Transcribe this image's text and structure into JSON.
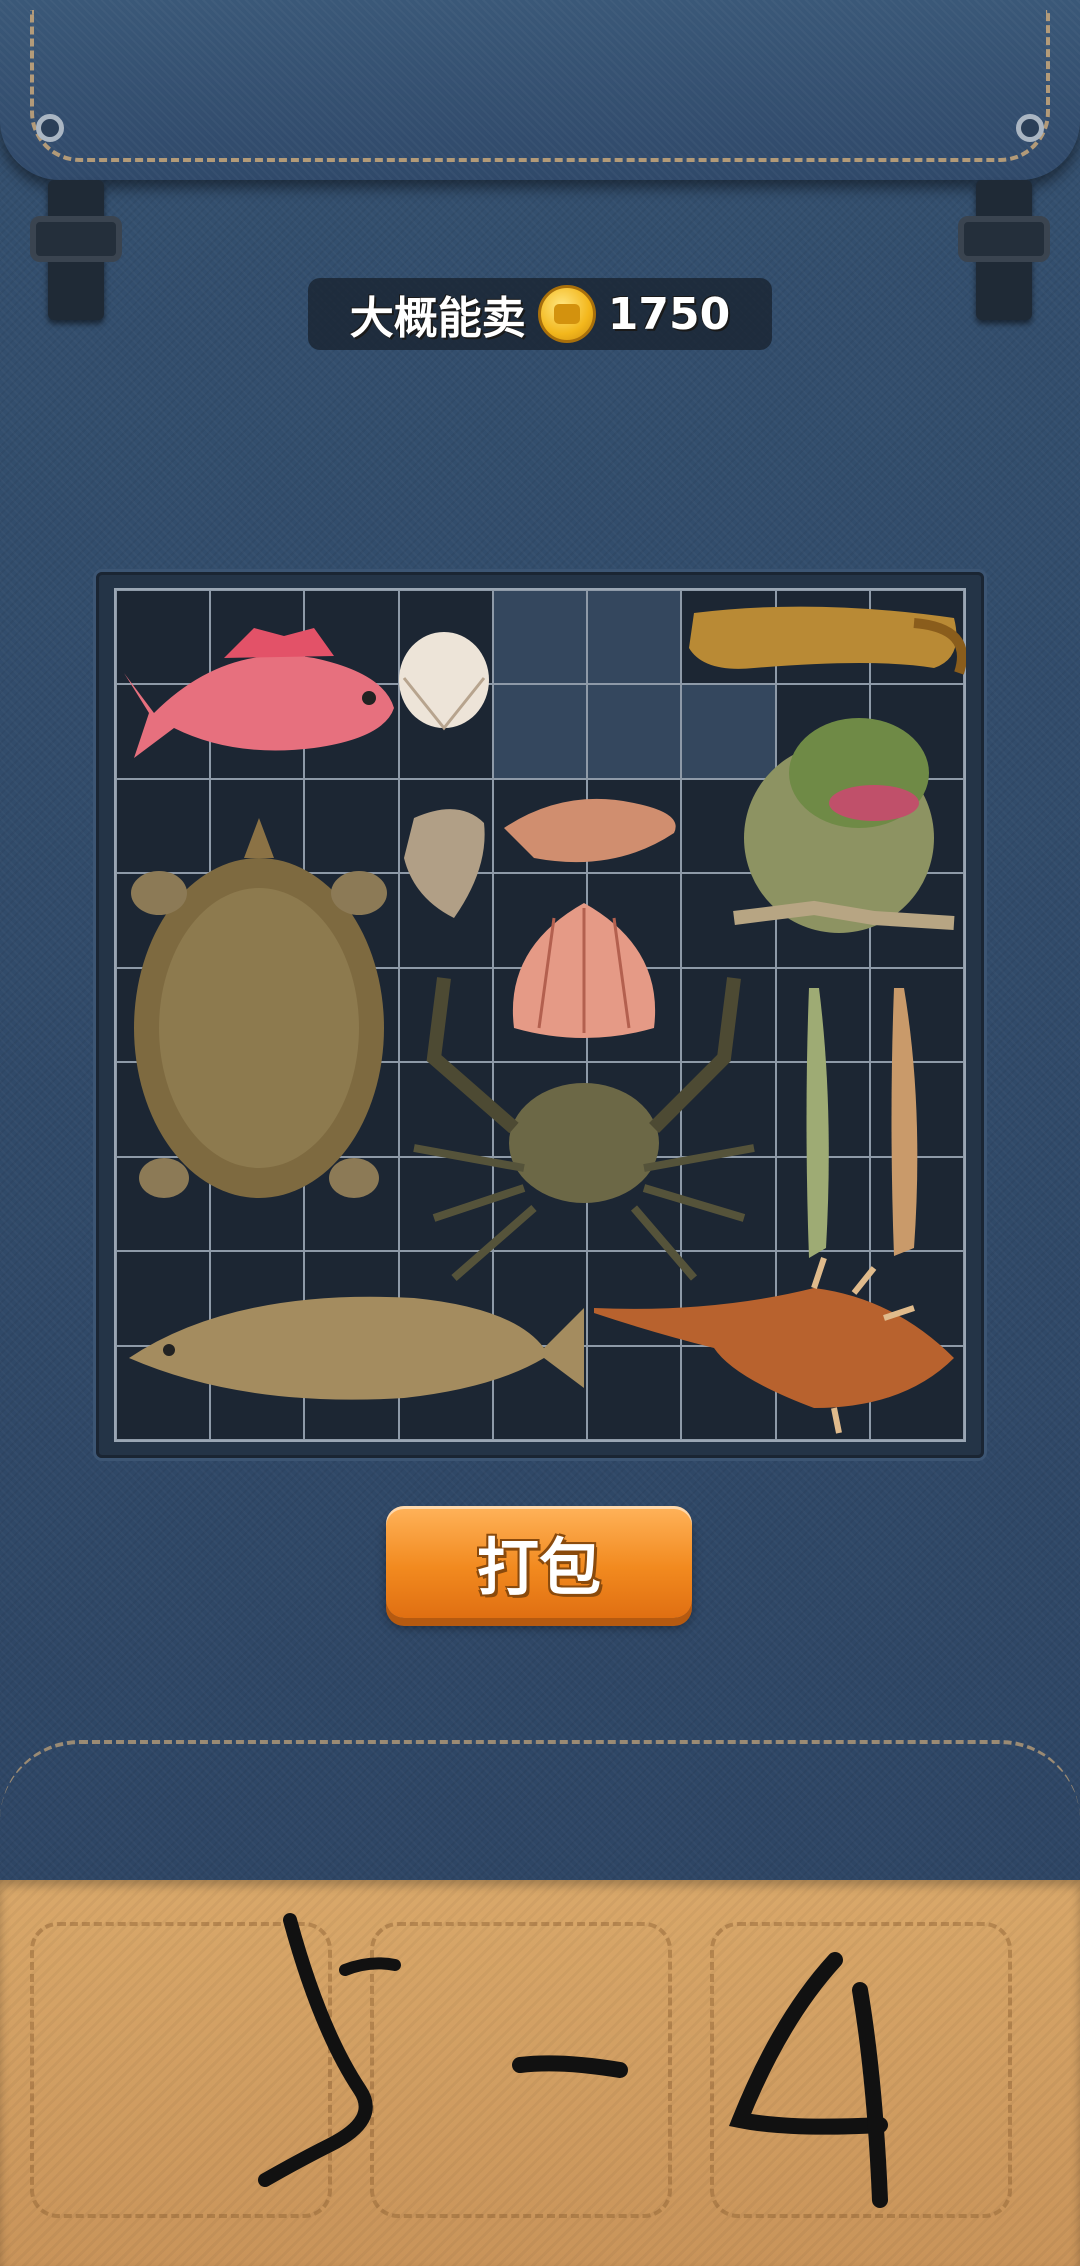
{
  "price_banner": {
    "label": "大概能卖",
    "coin_icon": "gold-coin-icon",
    "value": "1750"
  },
  "grid": {
    "columns": 9,
    "rows": 9,
    "empty_cells": [
      [
        0,
        4
      ],
      [
        0,
        5
      ],
      [
        1,
        4
      ],
      [
        1,
        5
      ],
      [
        1,
        6
      ]
    ]
  },
  "items": [
    {
      "name": "red-snapper",
      "kind": "fish"
    },
    {
      "name": "cockle-shell",
      "kind": "shell"
    },
    {
      "name": "mantis-shrimp",
      "kind": "crustacean"
    },
    {
      "name": "bullfrog",
      "kind": "amphibian"
    },
    {
      "name": "oyster",
      "kind": "shell"
    },
    {
      "name": "conch-shell",
      "kind": "shell"
    },
    {
      "name": "scallop-shell",
      "kind": "shell"
    },
    {
      "name": "soft-shell-turtle",
      "kind": "reptile"
    },
    {
      "name": "river-crab",
      "kind": "crustacean"
    },
    {
      "name": "green-shrimp",
      "kind": "crustacean"
    },
    {
      "name": "tiger-prawn",
      "kind": "crustacean"
    },
    {
      "name": "grass-carp",
      "kind": "fish"
    },
    {
      "name": "murex-shell",
      "kind": "shell"
    }
  ],
  "pack_button": {
    "label": "打包"
  },
  "colors": {
    "accent": "#f28a1f",
    "bag": "#2f4562",
    "wood": "#d9a86a"
  }
}
